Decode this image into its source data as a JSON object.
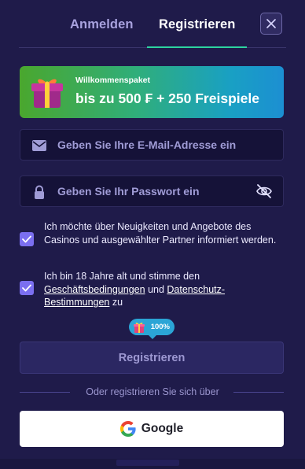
{
  "tabs": {
    "login": "Anmelden",
    "register": "Registrieren"
  },
  "promo": {
    "label": "Willkommenspaket",
    "headline": "bis zu 500 ₣ + 250 Freispiele"
  },
  "form": {
    "email_placeholder": "Geben Sie Ihre E-Mail-Adresse ein",
    "password_placeholder": "Geben Sie Ihr Passwort ein"
  },
  "consents": {
    "newsletter": {
      "checked": true,
      "text": "Ich möchte über Neuigkeiten und Angebote des Casinos und ausgewählter Partner informiert werden."
    },
    "terms": {
      "checked": true,
      "text_before": "Ich bin 18 Jahre alt und stimme den",
      "link_terms": "Geschäftsbedingungen",
      "text_mid": "und",
      "link_privacy": "Datenschutz-Bestimmungen",
      "text_after": "zu"
    }
  },
  "progress_badge": {
    "value": "100%"
  },
  "register_button": "Registrieren",
  "divider_text": "Oder registrieren Sie sich über",
  "social": {
    "google_label": "Google"
  },
  "colors": {
    "background": "#1f1b4a",
    "accent": "#2dd4a0",
    "checkbox": "#7b6ff0",
    "badge": "#2ba5d6"
  },
  "icons": [
    "close-icon",
    "gift-icon",
    "email-icon",
    "lock-icon",
    "eye-off-icon",
    "check-icon",
    "google-icon"
  ]
}
